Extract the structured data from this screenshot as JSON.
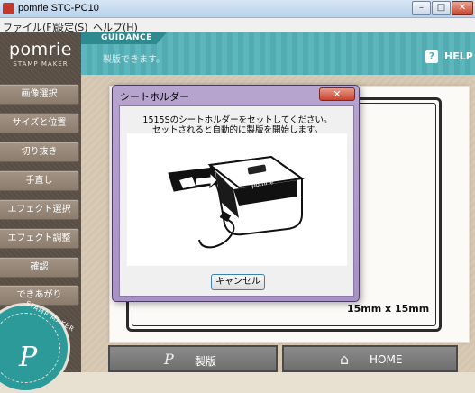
{
  "window": {
    "title": "pomrie STC-PC10",
    "controls": {
      "minimize": "–",
      "maximize": "□",
      "close": "✕"
    }
  },
  "menu": {
    "items": [
      "ファイル(F)",
      "設定(S)",
      "ヘルプ(H)"
    ]
  },
  "sidebar": {
    "logo": "pomrie",
    "logo_sub": "STAMP MAKER",
    "items": [
      {
        "label": "画像選択"
      },
      {
        "label": "サイズと位置"
      },
      {
        "label": "切り抜き"
      },
      {
        "label": "手直し"
      },
      {
        "label": "エフェクト選択"
      },
      {
        "label": "エフェクト調整"
      },
      {
        "label": "確認"
      },
      {
        "label": "できあがり"
      }
    ],
    "seal_text": "STAMP MAKER",
    "seal_letter": "P"
  },
  "guidance": {
    "label": "GUIDANCE",
    "text": "製版できます。",
    "help": "HELP",
    "help_icon": "?"
  },
  "canvas": {
    "size_label": "15mm x 15mm"
  },
  "bottom": {
    "make_label": "製版",
    "make_icon": "P",
    "home_label": "HOME",
    "home_icon": "⌂"
  },
  "dialog": {
    "title": "シートホルダー",
    "close": "✕",
    "message_line1": "1515Sのシートホルダーをセットしてください。",
    "message_line2": "セットされると自動的に製版を開始します。",
    "device_brand": "pomrie",
    "cancel": "キャンセル"
  },
  "colors": {
    "sidebar_bg": "#5a4f45",
    "nav_button": "#9a8b7d",
    "guidance_bg": "#54b2b8",
    "dialog_frame": "#a891c4",
    "seal": "#2d9a9a"
  }
}
